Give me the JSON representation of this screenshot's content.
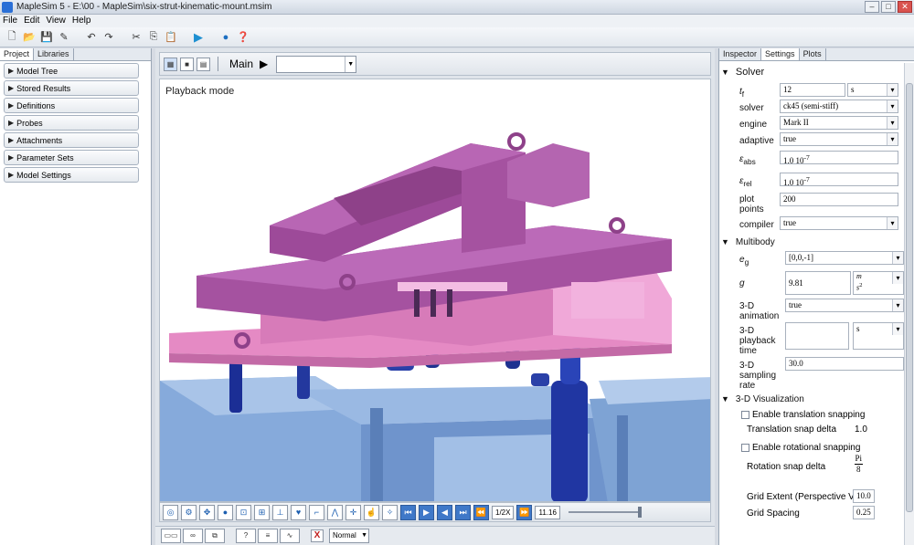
{
  "window": {
    "title": "MapleSim 5 -  E:\\00 - MapleSim\\six-strut-kinematic-mount.msim"
  },
  "menu": [
    "File",
    "Edit",
    "View",
    "Help"
  ],
  "left_panel": {
    "tabs": [
      "Project",
      "Libraries"
    ],
    "items": [
      "Model Tree",
      "Stored Results",
      "Definitions",
      "Probes",
      "Attachments",
      "Parameter Sets",
      "Model Settings"
    ]
  },
  "workspace": {
    "main_label": "Main",
    "main_select": "",
    "viewport_mode": "Playback mode",
    "speed": "1/2X",
    "time": "11.16",
    "mode_select": "Normal",
    "colors": {
      "beam_purple": "#a552a0",
      "plate_pink": "#e58ac4",
      "strut_blue": "#1b2e95",
      "base_blue": "#7ea3d4"
    }
  },
  "right_panel": {
    "tabs": [
      "Inspector",
      "Settings",
      "Plots"
    ],
    "solver": {
      "title": "Solver",
      "tf_symbol": "t",
      "tf_sub": "f",
      "tf_value": "12",
      "tf_unit": "s",
      "solver_label": "solver",
      "solver_value": "ck45 (semi-stiff)",
      "engine_label": "engine",
      "engine_value": "Mark II",
      "adaptive_label": "adaptive",
      "adaptive_value": "true",
      "eabs_sub": "abs",
      "eabs_value": "1.0 10",
      "eabs_exp": "-7",
      "erel_sub": "rel",
      "erel_value": "1.0 10",
      "erel_exp": "-7",
      "plot_points_label": "plot points",
      "plot_points_value": "200",
      "compiler_label": "compiler",
      "compiler_value": "true"
    },
    "multibody": {
      "title": "Multibody",
      "eg_symbol": "e",
      "eg_sub": "g",
      "eg_value": "[0,0,-1]",
      "g_symbol": "g",
      "g_value": "9.81",
      "g_unit_num": "m",
      "g_unit_den": "s",
      "g_unit_exp": "2",
      "anim_label": "3-D animation",
      "anim_value": "true",
      "playback_label": "3-D playback time",
      "playback_value": "",
      "playback_unit": "s",
      "sampling_label": "3-D sampling rate",
      "sampling_value": "30.0"
    },
    "visualization": {
      "title": "3-D Visualization",
      "translation_snap_label": "Enable translation snapping",
      "translation_delta_label": "Translation snap delta",
      "translation_delta_value": "1.0",
      "rotational_snap_label": "Enable rotational snapping",
      "rotation_delta_label": "Rotation snap delta",
      "rotation_num": "Pi",
      "rotation_den": "8",
      "grid_extent_label": "Grid Extent (Perspective View)",
      "grid_extent_value": "10.0",
      "grid_spacing_label": "Grid Spacing",
      "grid_spacing_value": "0.25"
    }
  }
}
